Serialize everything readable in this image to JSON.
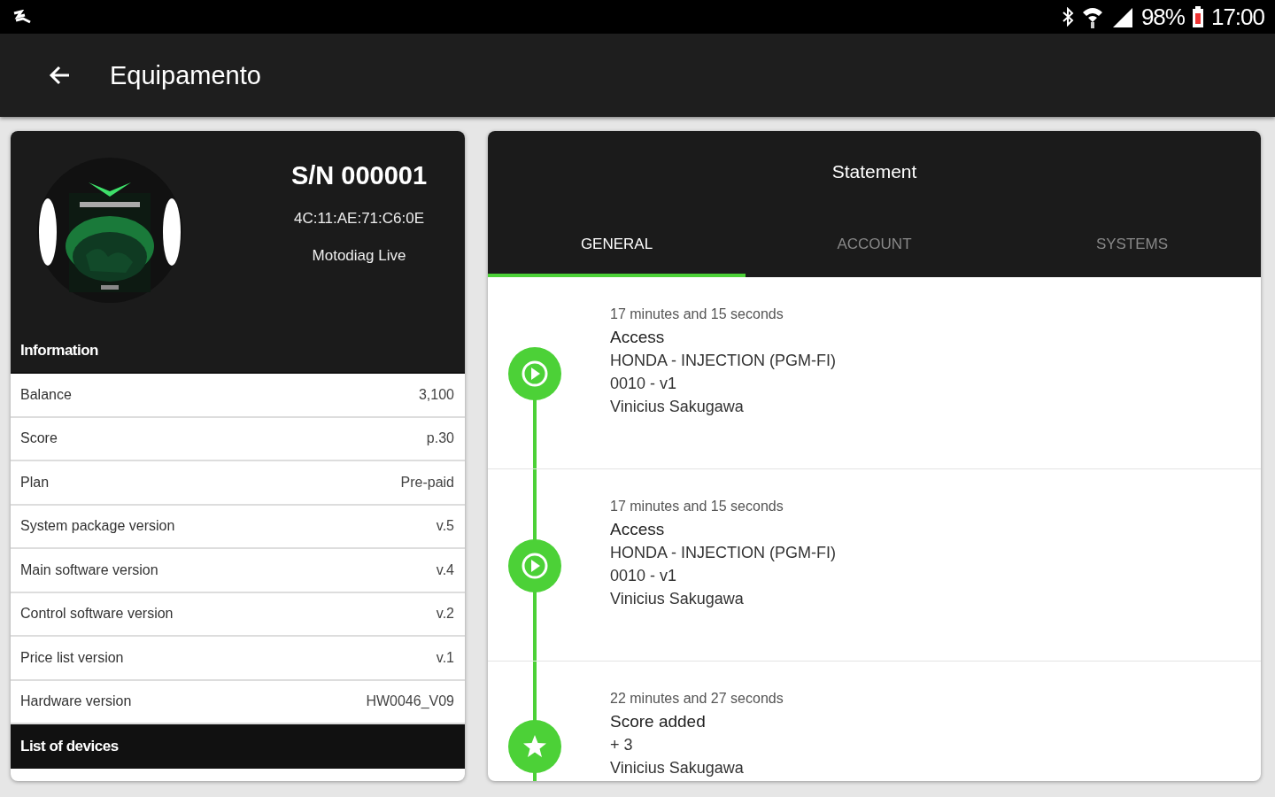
{
  "status_bar": {
    "battery_text": "98%",
    "time": "17:00"
  },
  "app_bar": {
    "title": "Equipamento"
  },
  "device": {
    "serial": "S/N 000001",
    "mac": "4C:11:AE:71:C6:0E",
    "model": "Motodiag Live"
  },
  "information": {
    "title": "Information",
    "rows": [
      {
        "label": "Balance",
        "value": "3,100"
      },
      {
        "label": "Score",
        "value": "p.30"
      },
      {
        "label": "Plan",
        "value": "Pre-paid"
      },
      {
        "label": "System package version",
        "value": "v.5"
      },
      {
        "label": "Main software version",
        "value": "v.4"
      },
      {
        "label": "Control software version",
        "value": "v.2"
      },
      {
        "label": "Price list version",
        "value": "v.1"
      },
      {
        "label": "Hardware version",
        "value": "HW0046_V09"
      }
    ]
  },
  "devices": {
    "title": "List of devices"
  },
  "statement": {
    "title": "Statement",
    "tabs": [
      {
        "label": "GENERAL",
        "selected": true
      },
      {
        "label": "ACCOUNT",
        "selected": false
      },
      {
        "label": "SYSTEMS",
        "selected": false
      }
    ],
    "events": [
      {
        "kind": "access",
        "time": "17 minutes and 15 seconds",
        "title": "Access",
        "lines": [
          "HONDA - INJECTION (PGM-FI)",
          "0010 - v1",
          "Vinicius Sakugawa"
        ]
      },
      {
        "kind": "access",
        "time": "17 minutes and 15 seconds",
        "title": "Access",
        "lines": [
          "HONDA - INJECTION (PGM-FI)",
          "0010 - v1",
          "Vinicius Sakugawa"
        ]
      },
      {
        "kind": "score",
        "time": "22 minutes and 27 seconds",
        "title": "Score added",
        "lines": [
          "+ 3",
          "Vinicius Sakugawa"
        ]
      }
    ]
  }
}
